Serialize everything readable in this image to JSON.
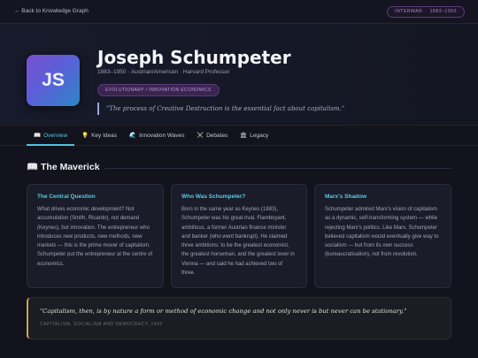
{
  "topbar": {
    "back_label": "← Back to Knowledge Graph",
    "era_label": "INTERWAR",
    "era_years": "1883–1950"
  },
  "hero": {
    "initials": "JS",
    "name": "Joseph Schumpeter",
    "meta": "1883–1950 · Austrian/American · Harvard Professor",
    "school_badge": "EVOLUTIONARY / INNOVATION ECONOMICS",
    "quote": "\"The process of Creative Destruction is the essential fact about capitalism.\""
  },
  "tabs": [
    {
      "icon": "📖",
      "label": "Overview",
      "active": true
    },
    {
      "icon": "💡",
      "label": "Key Ideas",
      "active": false
    },
    {
      "icon": "🌊",
      "label": "Innovation Waves",
      "active": false
    },
    {
      "icon": "⚔️",
      "label": "Debates",
      "active": false
    },
    {
      "icon": "🏛",
      "label": "Legacy",
      "active": false
    }
  ],
  "section": {
    "icon": "📖",
    "title": "The Maverick"
  },
  "cards": [
    {
      "title": "The Central Question",
      "body": "What drives economic development? Not accumulation (Smith, Ricardo), not demand (Keynes), but innovation. The entrepreneur who introduces new products, new methods, new markets — this is the prime mover of capitalism. Schumpeter put the entrepreneur at the centre of economics."
    },
    {
      "title": "Who Was Schumpeter?",
      "body": "Born in the same year as Keynes (1883), Schumpeter was his great rival. Flamboyant, ambitious, a former Austrian finance minister and banker (who went bankrupt). He claimed three ambitions: to be the greatest economist, the greatest horseman, and the greatest lover in Vienna — and said he had achieved two of three."
    },
    {
      "title": "Marx's Shadow",
      "body": "Schumpeter admired Marx's vision of capitalism as a dynamic, self-transforming system — while rejecting Marx's politics. Like Marx, Schumpeter believed capitalism would eventually give way to socialism — but from its own success (bureaucratisation), not from revolution."
    }
  ],
  "pull_quote": {
    "text": "\"Capitalism, then, is by nature a form or method of economic change and not only never is but never can be stationary.\"",
    "source": "CAPITALISM, SOCIALISM AND DEMOCRACY, 1942"
  },
  "colors": {
    "accent": "#4cc3dc",
    "badge_purple": "#c09ae2",
    "quote_gold": "#c9a84a"
  }
}
